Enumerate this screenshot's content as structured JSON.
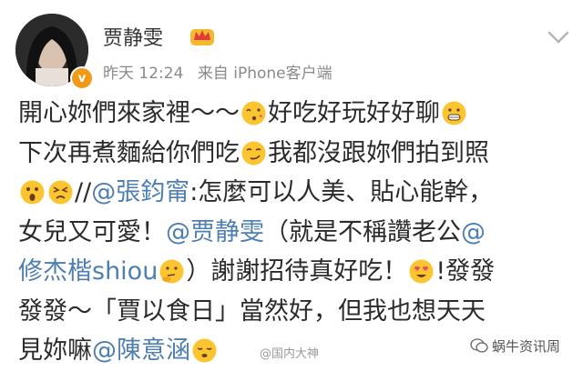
{
  "header": {
    "name": "贾静雯",
    "time": "昨天 12:24",
    "source": "来自 iPhone客户端",
    "verified_mark": "v"
  },
  "post": {
    "l1_a": "開心妳們來家裡～～",
    "l1_b": "好吃好玩好好聊",
    "l2_a": "下次再煮麵給你們吃",
    "l2_b": "我都沒跟妳們拍到照",
    "l3_a": "//",
    "l3_mention": "@張鈞甯",
    "l3_b": ":怎麼可以人美、貼心能幹，",
    "l4_a": "女兒又可愛！",
    "l4_mention": "@贾静雯",
    "l4_b": "（就是不稱讚老公",
    "l4_at": "@",
    "l5_mention": "修杰楷shiou",
    "l5_b": "）謝謝招待真好吃！",
    "l5_c": "!發發",
    "l6": "發發～「賈以食日」當然好，但我也想天天",
    "l7_a": "見妳嘛",
    "l7_mention": "@陳意涵"
  },
  "watermark": {
    "left": "@国内大神",
    "right": "蜗牛资讯周"
  },
  "icons": {
    "crown": "crown-icon",
    "chevron": "chevron-down-icon",
    "wechat": "wechat-icon"
  },
  "colors": {
    "mention": "#4d7fb3",
    "meta": "#8a8a8a",
    "verified": "#f29a18",
    "text": "#2b2b2b"
  }
}
